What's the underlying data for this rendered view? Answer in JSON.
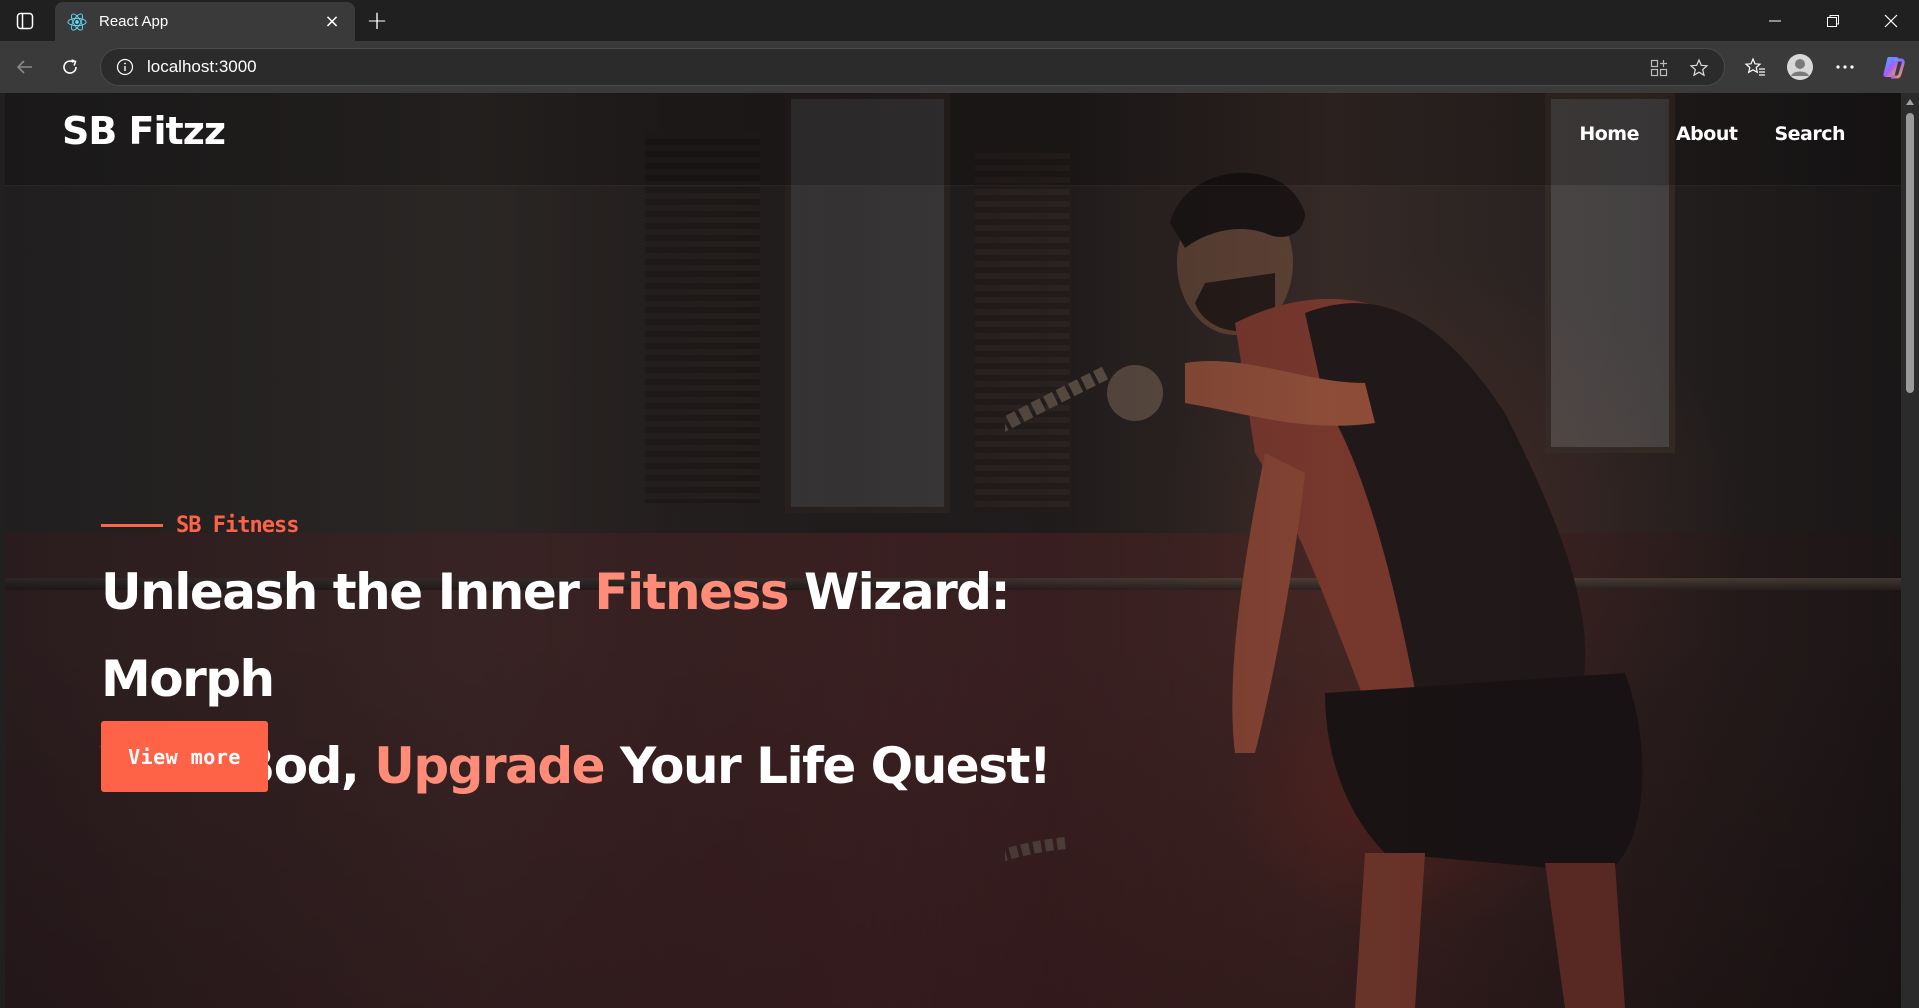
{
  "browser": {
    "tab_title": "React App",
    "url": "localhost:3000",
    "icons": {
      "sidebar": "tab-actions-icon",
      "favicon": "react-logo-icon",
      "close_tab": "close-icon",
      "new_tab": "plus-icon",
      "minimize": "minimize-icon",
      "restore": "restore-icon",
      "close_window": "close-icon",
      "back": "back-arrow-icon",
      "reload": "reload-icon",
      "site_info": "info-icon",
      "app_available": "app-install-icon",
      "favorite": "star-icon",
      "favorites": "favorites-icon",
      "profile": "profile-icon",
      "more": "more-icon",
      "copilot": "copilot-icon"
    },
    "new_tab_symbol": "+",
    "close_symbol": "×"
  },
  "site": {
    "logo": "SB Fitzz",
    "nav": [
      {
        "label": "Home"
      },
      {
        "label": "About"
      },
      {
        "label": "Search"
      }
    ],
    "hero": {
      "eyebrow": "SB Fitness",
      "headline_parts": {
        "part1": "Unleash the Inner ",
        "accent1": "Fitness",
        "part2": " Wizard: Morph",
        "part3": "Your Bod, ",
        "accent2": "Upgrade",
        "part4": " Your Life Quest!"
      },
      "cta_label": "View more"
    },
    "colors": {
      "accent": "#ff6347",
      "accent_light": "#ff8c78",
      "text": "#ffffff"
    }
  }
}
